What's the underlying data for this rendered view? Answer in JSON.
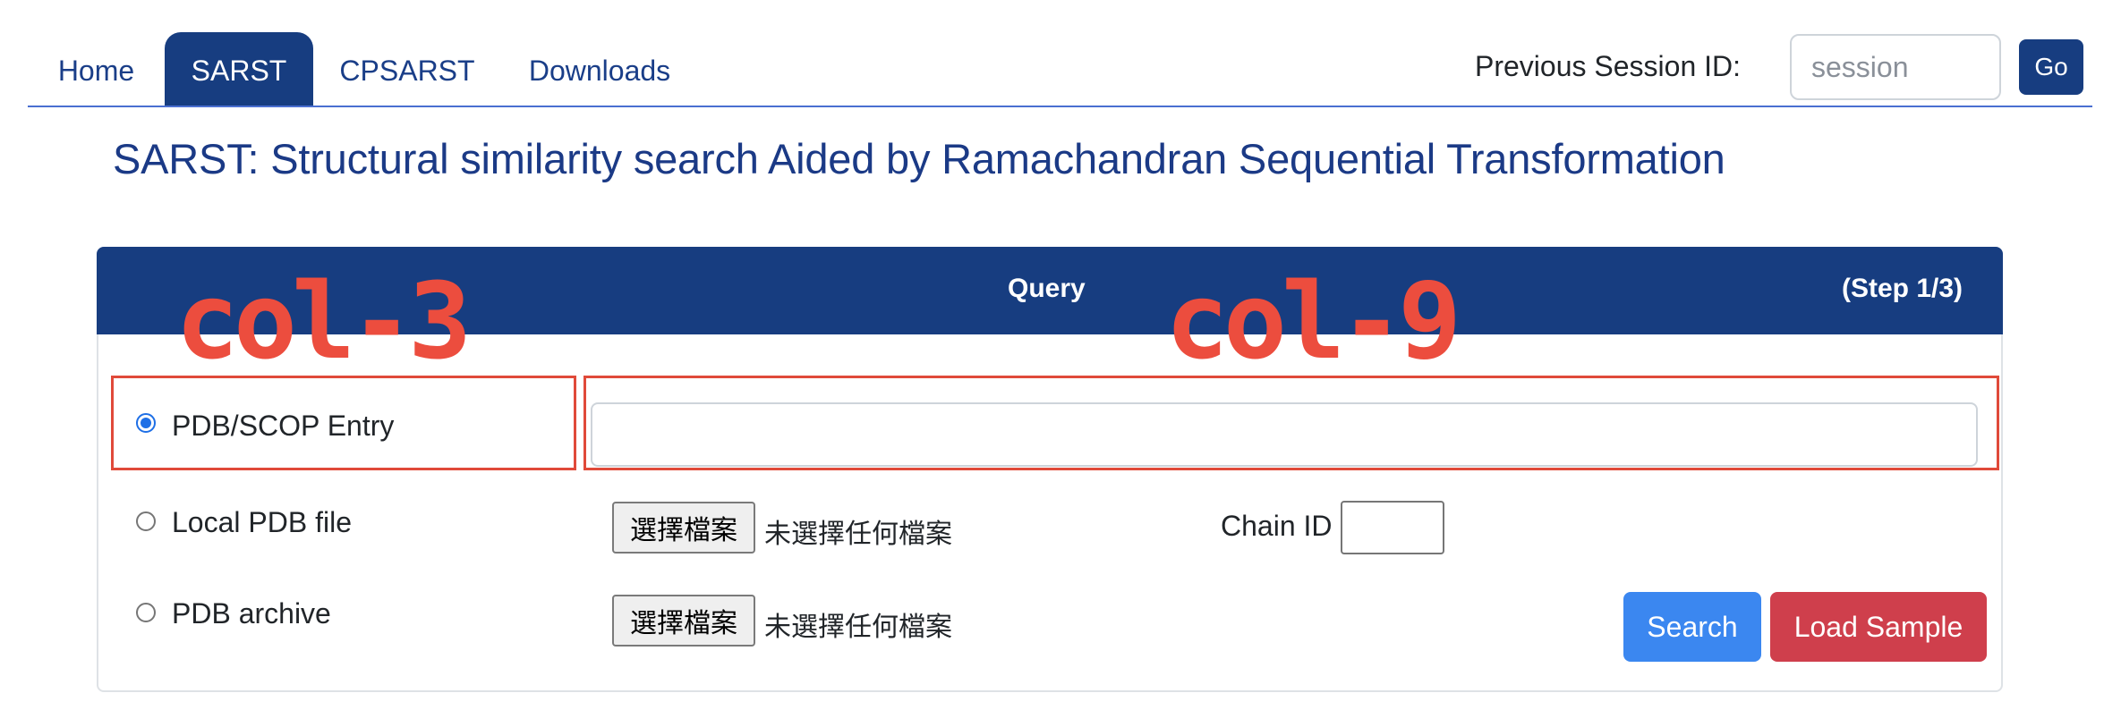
{
  "nav": {
    "items": [
      {
        "label": "Home"
      },
      {
        "label": "SARST"
      },
      {
        "label": "CPSARST"
      },
      {
        "label": "Downloads"
      }
    ],
    "active_index": 1,
    "session_label": "Previous Session ID:",
    "session_placeholder": "session",
    "go_label": "Go"
  },
  "title": "SARST: Structural similarity search Aided by Ramachandran Sequential Transformation",
  "card": {
    "title": "Query",
    "step": "(Step 1/3)"
  },
  "annotations": {
    "left": "col-3",
    "right": "col-9"
  },
  "rows": [
    {
      "label": "PDB/SCOP Entry",
      "checked": true
    },
    {
      "label": "Local PDB file",
      "checked": false
    },
    {
      "label": "PDB archive",
      "checked": false
    }
  ],
  "file_inputs": [
    {
      "button": "選擇檔案",
      "status": "未選擇任何檔案"
    },
    {
      "button": "選擇檔案",
      "status": "未選擇任何檔案"
    }
  ],
  "chain": {
    "label": "Chain ID",
    "value": ""
  },
  "buttons": {
    "search": "Search",
    "load_sample": "Load Sample"
  },
  "colors": {
    "navy": "#173d80",
    "title": "#1b3a86",
    "annotation": "#ec4d3e",
    "search": "#3b87f0",
    "load_sample": "#cf3f4c"
  }
}
